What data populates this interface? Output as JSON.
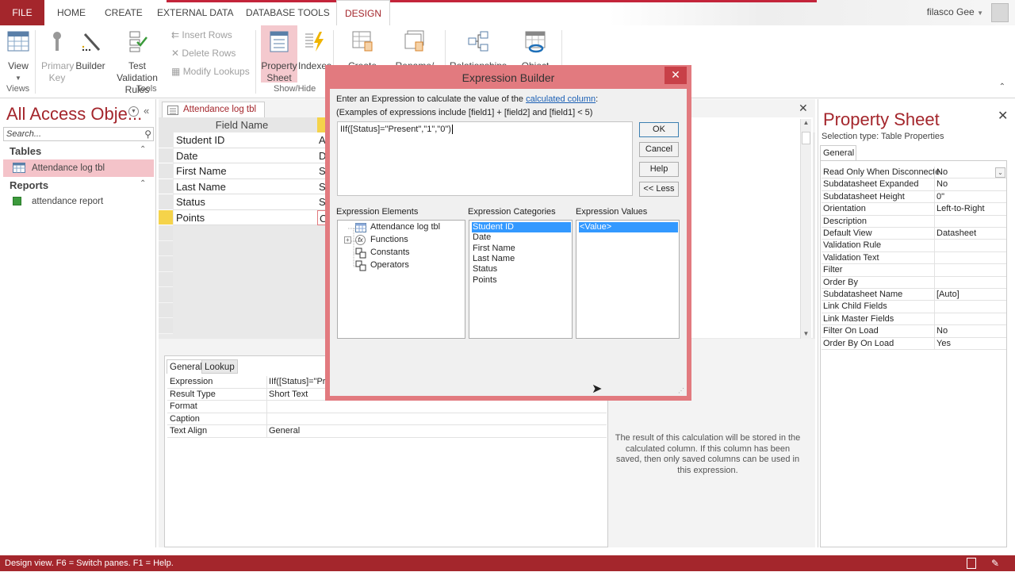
{
  "ribbon_tabs": [
    "FILE",
    "HOME",
    "CREATE",
    "EXTERNAL DATA",
    "DATABASE TOOLS",
    "DESIGN"
  ],
  "active_tab": "DESIGN",
  "user": {
    "name": "filasco Gee",
    "dropdown_icon": "caret-down-icon"
  },
  "ribbon": {
    "view": {
      "label": "View"
    },
    "primary_key": {
      "line1": "Primary",
      "line2": "Key"
    },
    "builder": {
      "label": "Builder"
    },
    "test_validation": {
      "line1": "Test Validation",
      "line2": "Rules"
    },
    "insert_rows": "Insert Rows",
    "delete_rows": "Delete Rows",
    "modify_lookups": "Modify Lookups",
    "property_sheet": {
      "line1": "Property",
      "line2": "Sheet"
    },
    "indexes": {
      "label": "Indexes"
    },
    "create_data": {
      "label": "Create Data"
    },
    "rename": {
      "label": "Rename/"
    },
    "relationships": {
      "label": "Relationships"
    },
    "object": {
      "label": "Object"
    },
    "groups": {
      "views": "Views",
      "tools": "Tools",
      "show_hide": "Show/Hide"
    }
  },
  "nav": {
    "title": "All Access Obje...",
    "search_placeholder": "Search...",
    "sections": [
      {
        "label": "Tables",
        "items": [
          "Attendance log tbl"
        ]
      },
      {
        "label": "Reports",
        "items": [
          "attendance report"
        ]
      }
    ]
  },
  "document": {
    "tab_label": "Attendance log tbl",
    "field_name_header": "Field Name",
    "fields": [
      {
        "name": "Student ID",
        "type_initial": "A"
      },
      {
        "name": "Date",
        "type_initial": "D"
      },
      {
        "name": "First Name",
        "type_initial": "S"
      },
      {
        "name": "Last Name",
        "type_initial": "S"
      },
      {
        "name": "Status",
        "type_initial": "S"
      },
      {
        "name": "Points",
        "type_initial": "C"
      }
    ],
    "selected_field": "Points"
  },
  "field_properties": {
    "tabs": [
      "General",
      "Lookup"
    ],
    "active_tab": "General",
    "rows": [
      {
        "key": "Expression",
        "value": "IIf([Status]=\"Pre"
      },
      {
        "key": "Result Type",
        "value": "Short Text"
      },
      {
        "key": "Format",
        "value": ""
      },
      {
        "key": "Caption",
        "value": ""
      },
      {
        "key": "Text Align",
        "value": "General"
      }
    ],
    "hint": "The result of this calculation will be stored in the calculated column. If this column has been saved, then only saved columns can be used in this expression."
  },
  "property_sheet": {
    "title": "Property Sheet",
    "selection_type": "Selection type:  Table Properties",
    "tab": "General",
    "rows": [
      {
        "key": "Read Only When Disconnecte",
        "value": "No"
      },
      {
        "key": "Subdatasheet Expanded",
        "value": "No"
      },
      {
        "key": "Subdatasheet Height",
        "value": "0\""
      },
      {
        "key": "Orientation",
        "value": "Left-to-Right"
      },
      {
        "key": "Description",
        "value": ""
      },
      {
        "key": "Default View",
        "value": "Datasheet"
      },
      {
        "key": "Validation Rule",
        "value": ""
      },
      {
        "key": "Validation Text",
        "value": ""
      },
      {
        "key": "Filter",
        "value": ""
      },
      {
        "key": "Order By",
        "value": ""
      },
      {
        "key": "Subdatasheet Name",
        "value": "[Auto]"
      },
      {
        "key": "Link Child Fields",
        "value": ""
      },
      {
        "key": "Link Master Fields",
        "value": ""
      },
      {
        "key": "Filter On Load",
        "value": "No"
      },
      {
        "key": "Order By On Load",
        "value": "Yes"
      }
    ]
  },
  "dialog": {
    "title": "Expression Builder",
    "instruction_prefix": "Enter an Expression to calculate the value of the ",
    "instruction_link": "calculated column",
    "instruction_suffix": ":",
    "examples": "(Examples of expressions include [field1] + [field2] and [field1] < 5)",
    "expression": "IIf([Status]=\"Present\",\"1\",\"0\")",
    "buttons": {
      "ok": "OK",
      "cancel": "Cancel",
      "help": "Help",
      "less": "<< Less"
    },
    "elements_label": "Expression Elements",
    "categories_label": "Expression Categories",
    "values_label": "Expression Values",
    "elements": [
      "Attendance log tbl",
      "Functions",
      "Constants",
      "Operators"
    ],
    "categories": [
      "Student ID",
      "Date",
      "First Name",
      "Last Name",
      "Status",
      "Points"
    ],
    "selected_category": "Student ID",
    "values": [
      "<Value>"
    ]
  },
  "status_bar": {
    "text": "Design view.  F6 = Switch panes.  F1 = Help."
  },
  "colors": {
    "accent": "#a4262c",
    "dialog_frame": "#e27a7f",
    "selection": "#3399ff"
  }
}
